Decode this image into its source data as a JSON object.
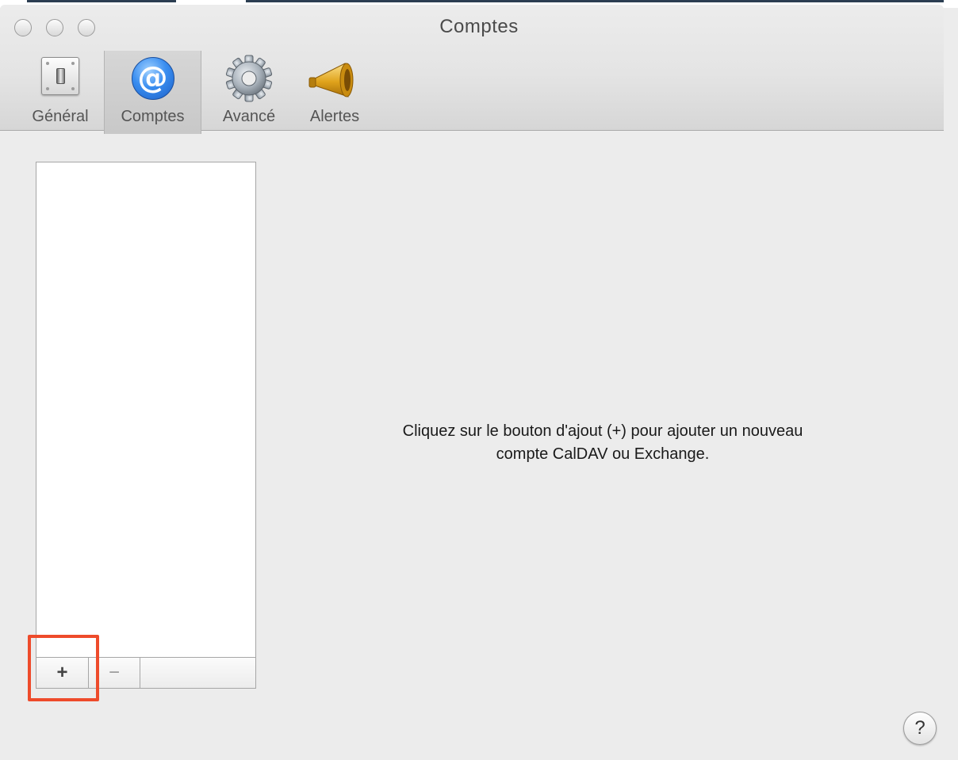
{
  "window": {
    "title": "Comptes"
  },
  "toolbar": {
    "items": [
      {
        "label": "Général",
        "icon": "light-switch-icon",
        "selected": false
      },
      {
        "label": "Comptes",
        "icon": "at-sign-icon",
        "selected": true
      },
      {
        "label": "Avancé",
        "icon": "gear-icon",
        "selected": false
      },
      {
        "label": "Alertes",
        "icon": "megaphone-icon",
        "selected": false
      }
    ]
  },
  "accounts": {
    "items": [],
    "add_label": "+",
    "remove_label": "−"
  },
  "main": {
    "message_line1": "Cliquez sur le bouton d'ajout (+) pour ajouter un nouveau",
    "message_line2": "compte CalDAV ou Exchange."
  },
  "help": {
    "label": "?"
  },
  "colors": {
    "highlight": "#ee4b2b",
    "at_icon_blue": "#3a8ef0",
    "megaphone_gold": "#e0a31c"
  }
}
